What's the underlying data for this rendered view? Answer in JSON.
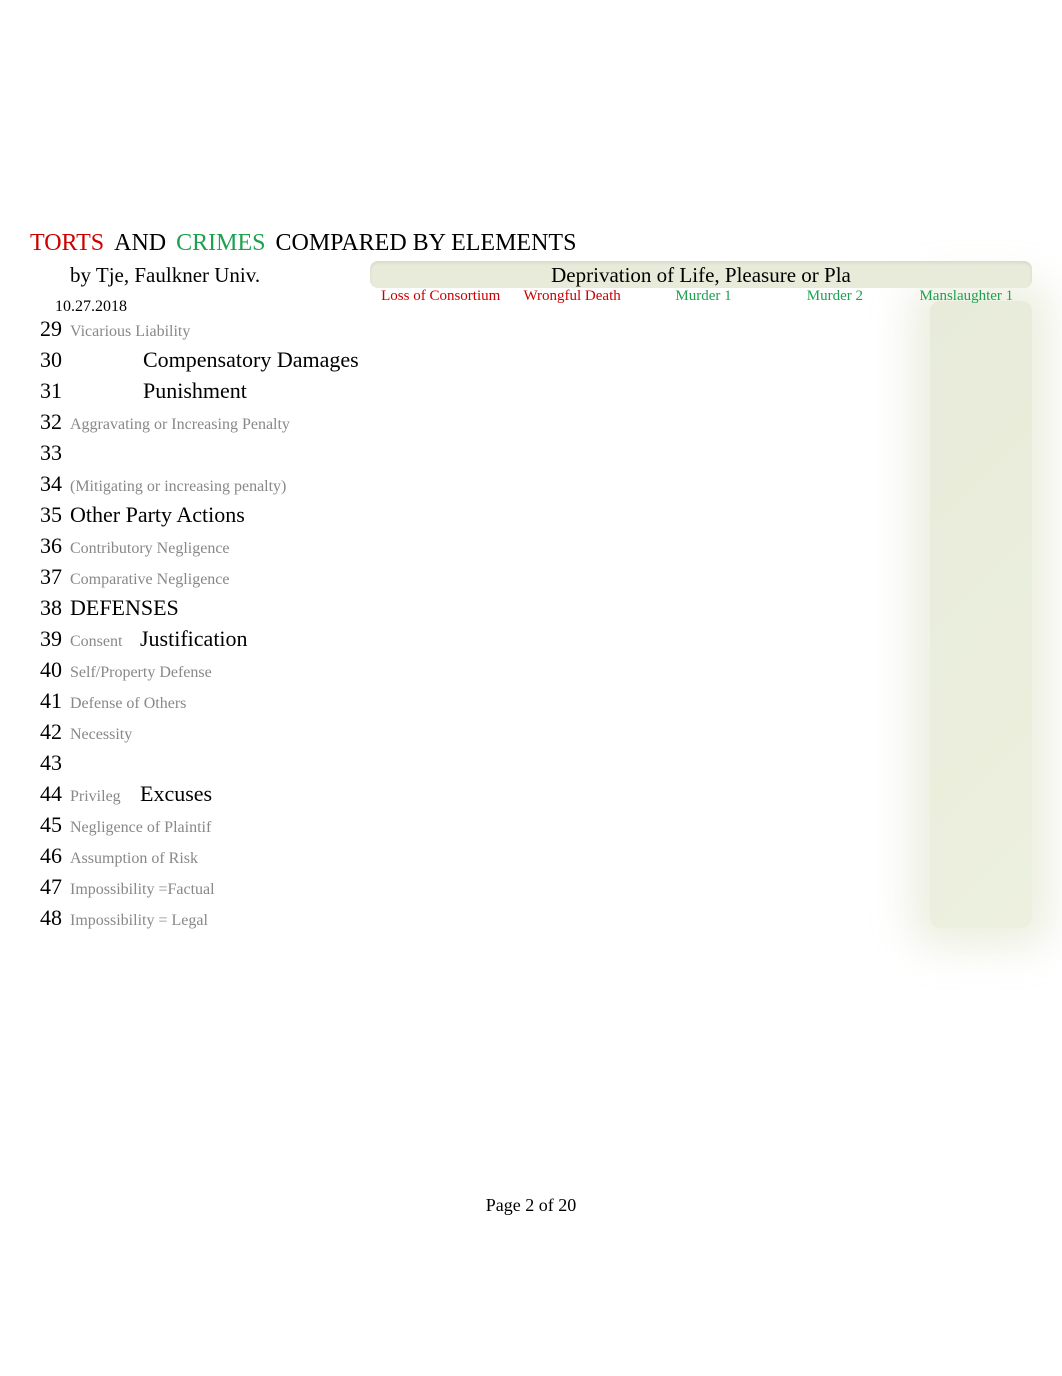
{
  "title": {
    "torts": "TORTS",
    "and": "AND",
    "crimes": "CRIMES",
    "rest": "COMPARED BY ELEMENTS"
  },
  "byline": "by Tje, Faulkner Univ.",
  "section_header": "Deprivation of Life, Pleasure or Pla",
  "date": "10.27.2018",
  "columns": [
    {
      "label": "Loss of Consortium",
      "color": "red"
    },
    {
      "label": "Wrongful Death",
      "color": "red"
    },
    {
      "label": "Murder 1",
      "color": "green"
    },
    {
      "label": "Murder 2",
      "color": "green"
    },
    {
      "label": "Manslaughter 1",
      "color": "green"
    }
  ],
  "rows": [
    {
      "num": "29",
      "small": "Vicarious Liability",
      "big": "",
      "indent": false
    },
    {
      "num": "30",
      "small": "",
      "big": "Compensatory Damages",
      "indent": true
    },
    {
      "num": "31",
      "small": "",
      "big": "Punishment",
      "indent": true
    },
    {
      "num": "32",
      "small": "Aggravating or Increasing Penalty",
      "big": "",
      "indent": false
    },
    {
      "num": "33",
      "small": "",
      "big": "",
      "indent": false
    },
    {
      "num": "34",
      "small": "(Mitigating or increasing penalty)",
      "big": "",
      "indent": false
    },
    {
      "num": "35",
      "small": "",
      "big": "Other Party Actions",
      "indent": false
    },
    {
      "num": "36",
      "small": "Contributory Negligence",
      "big": "",
      "indent": false
    },
    {
      "num": "37",
      "small": "Comparative Negligence",
      "big": "",
      "indent": false
    },
    {
      "num": "38",
      "small": "",
      "big": "DEFENSES",
      "indent": false
    },
    {
      "num": "39",
      "small": "Consent",
      "big": "Justification",
      "indent": false,
      "both": true
    },
    {
      "num": "40",
      "small": "Self/Property Defense",
      "big": "",
      "indent": false
    },
    {
      "num": "41",
      "small": "Defense of Others",
      "big": "",
      "indent": false
    },
    {
      "num": "42",
      "small": "Necessity",
      "big": "",
      "indent": false
    },
    {
      "num": "43",
      "small": "",
      "big": "",
      "indent": false
    },
    {
      "num": "44",
      "small": "Privileg",
      "big": "Excuses",
      "indent": false,
      "both": true
    },
    {
      "num": "45",
      "small": "Negligence of Plaintif",
      "big": "",
      "indent": false
    },
    {
      "num": "46",
      "small": "Assumption of Risk",
      "big": "",
      "indent": false
    },
    {
      "num": "47",
      "small": "Impossibility =Factual",
      "big": "",
      "indent": false
    },
    {
      "num": "48",
      "small": "Impossibility = Legal",
      "big": "",
      "indent": false
    }
  ],
  "footer": "Page 2 of 20"
}
